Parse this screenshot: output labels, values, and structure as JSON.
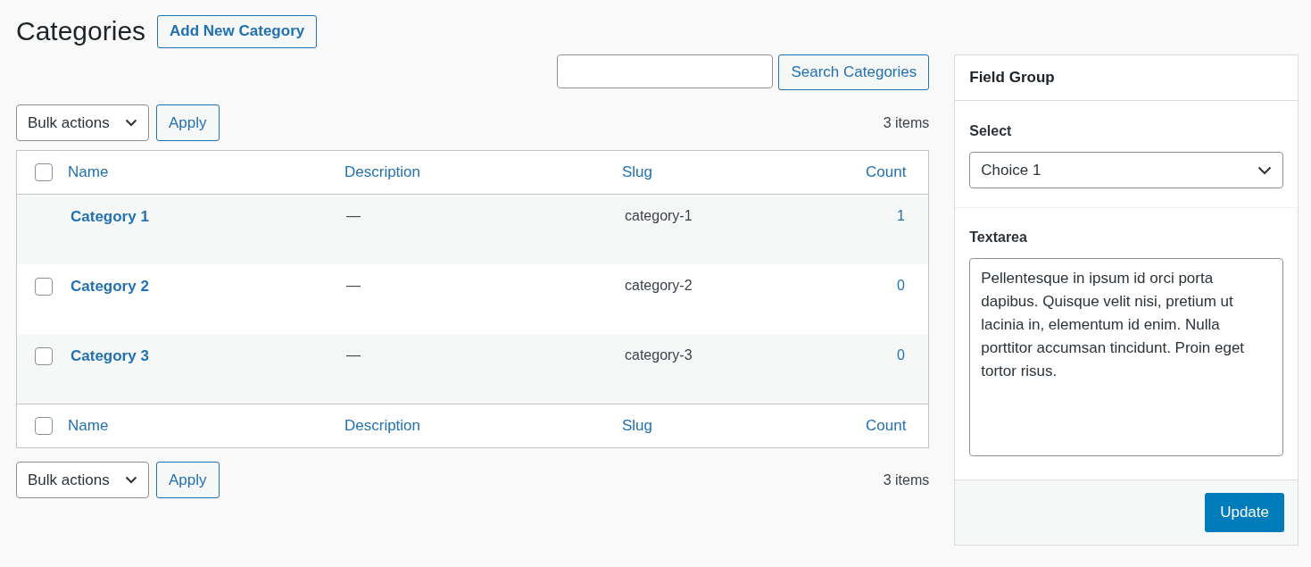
{
  "page_title": "Categories",
  "add_button": "Add New Category",
  "search": {
    "button": "Search Categories"
  },
  "top_nav": {
    "bulk_actions": "Bulk actions",
    "apply": "Apply",
    "items_count": "3 items"
  },
  "table": {
    "header_checked": false,
    "footer_checked": false,
    "columns": [
      "Name",
      "Description",
      "Slug",
      "Count"
    ],
    "footer_columns": [
      "Name",
      "Description",
      "Slug",
      "Count"
    ],
    "rows": [
      {
        "name": "Category 1",
        "description": "—",
        "slug": "category-1",
        "count": "1"
      },
      {
        "name": "Category 2",
        "description": "—",
        "slug": "category-2",
        "count": "0",
        "checkbox": {
          "checked": false
        }
      },
      {
        "name": "Category 3",
        "description": "—",
        "slug": "category-3",
        "count": "0",
        "checkbox": {
          "checked": false
        }
      }
    ]
  },
  "bottom_nav": {
    "bulk_actions": "Bulk actions",
    "apply": "Apply",
    "items_count": "3 items"
  },
  "panel": {
    "title": "Field Group",
    "fields": [
      {
        "kind": "select",
        "label": "Select",
        "value": "Choice 1"
      },
      {
        "kind": "textarea",
        "label": "Textarea",
        "value": "Pellentesque in ipsum id orci porta dapibus. Quisque velit nisi, pretium ut lacinia in, elementum id enim. Nulla porttitor accumsan tincidunt. Proin eget tortor risus."
      }
    ],
    "button": "Update"
  }
}
